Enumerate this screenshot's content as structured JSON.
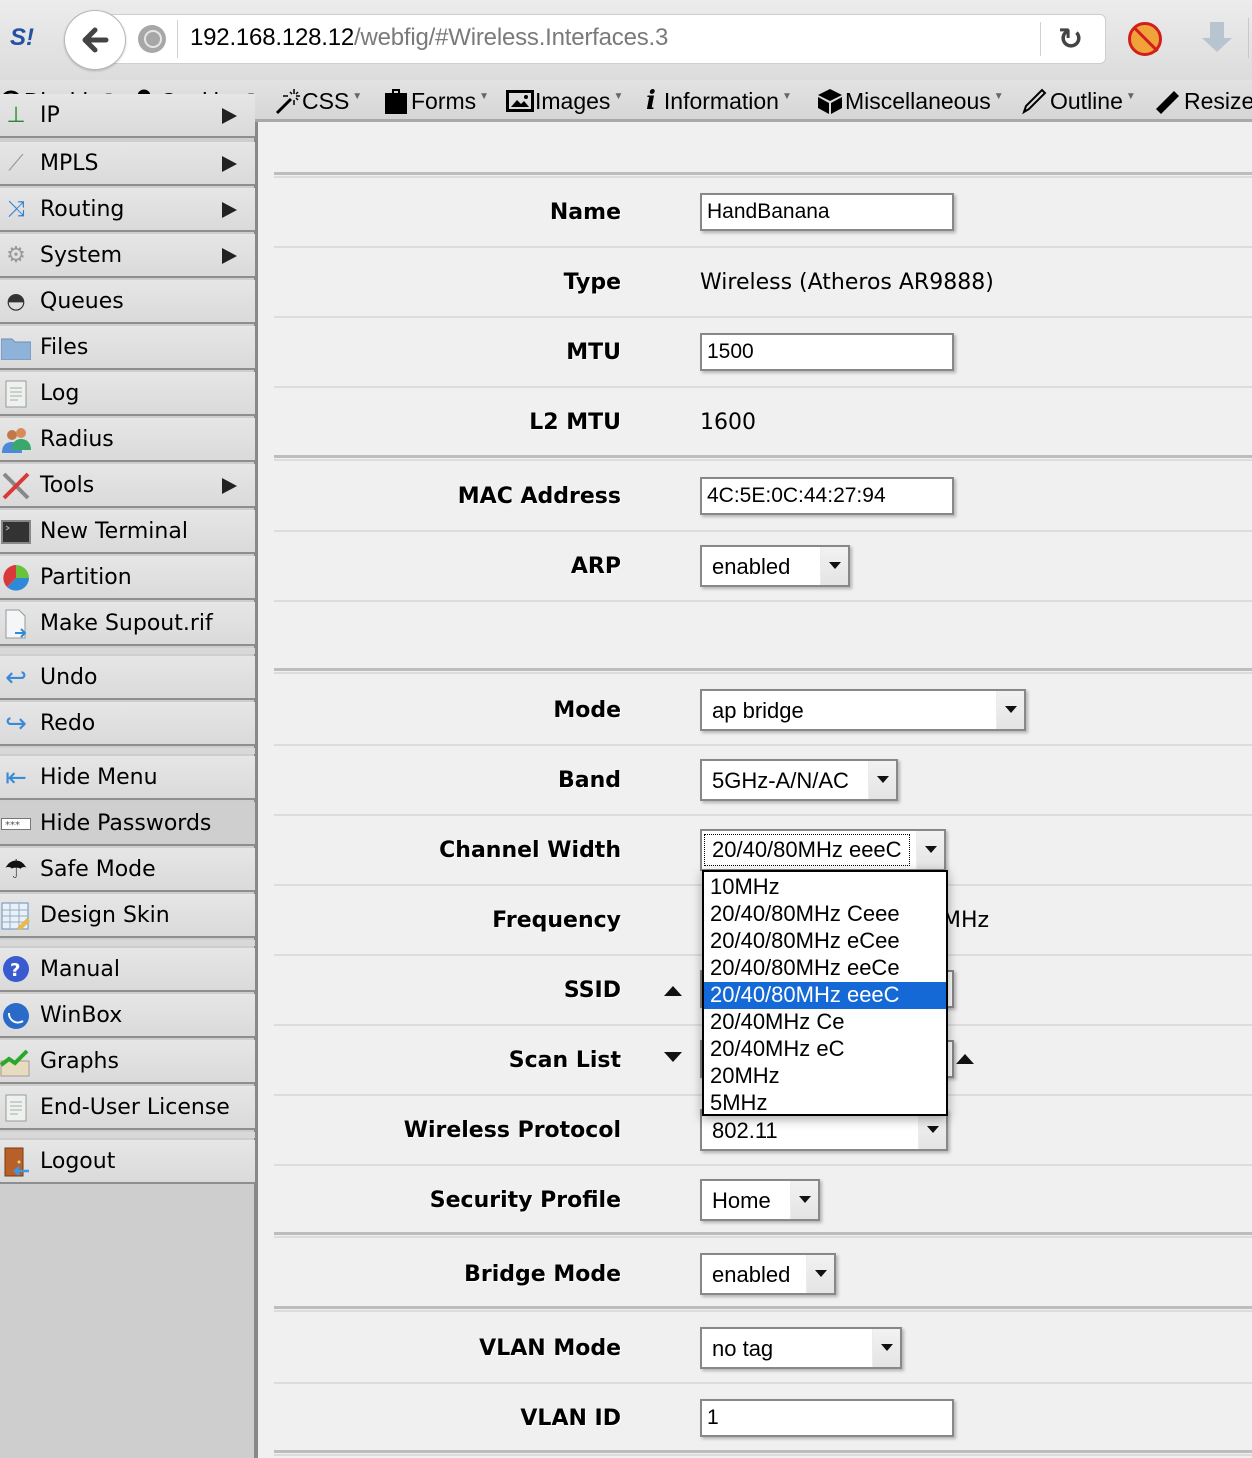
{
  "browser": {
    "url_host": "192.168.128.12",
    "url_path": "/webfig/#Wireless.Interfaces.3",
    "extension_logo": "S!",
    "icons": [
      "back-arrow-icon",
      "globe-icon",
      "reload-icon",
      "noscript-icon",
      "download-icon"
    ]
  },
  "dev_toolbar": {
    "items": [
      {
        "label": "Disable",
        "icon": "⃠",
        "has_menu": true
      },
      {
        "label": "Cookies",
        "icon": "👤",
        "has_menu": true
      },
      {
        "label": "CSS",
        "icon": "✨",
        "has_menu": true
      },
      {
        "label": "Forms",
        "icon": "📋",
        "has_menu": true
      },
      {
        "label": "Images",
        "icon": "🖼",
        "has_menu": true
      },
      {
        "label": "Information",
        "icon": "𝒊",
        "has_menu": true
      },
      {
        "label": "Miscellaneous",
        "icon": "📦",
        "has_menu": true
      },
      {
        "label": "Outline",
        "icon": "✎",
        "has_menu": true
      },
      {
        "label": "Resize",
        "icon": "📏",
        "has_menu": false
      }
    ]
  },
  "sidebar": {
    "items": [
      {
        "label": "IP",
        "icon": "ip-icon",
        "glyph": "⊥",
        "submenu": true
      },
      {
        "label": "MPLS",
        "icon": "mpls-tags-icon",
        "glyph": "🏷",
        "submenu": true
      },
      {
        "label": "Routing",
        "icon": "routing-icon",
        "glyph": "⤨",
        "submenu": true
      },
      {
        "label": "System",
        "icon": "gear-icon",
        "glyph": "⚙",
        "submenu": true
      },
      {
        "label": "Queues",
        "icon": "gauge-icon",
        "glyph": "◓",
        "submenu": false
      },
      {
        "label": "Files",
        "icon": "folder-icon",
        "glyph": "📁",
        "submenu": false
      },
      {
        "label": "Log",
        "icon": "log-document-icon",
        "glyph": "▤",
        "submenu": false
      },
      {
        "label": "Radius",
        "icon": "users-icon",
        "glyph": "👥",
        "submenu": false
      },
      {
        "label": "Tools",
        "icon": "tools-icon",
        "glyph": "✂",
        "submenu": true
      },
      {
        "label": "New Terminal",
        "icon": "terminal-icon",
        "glyph": "▬",
        "submenu": false
      },
      {
        "label": "Partition",
        "icon": "pie-chart-icon",
        "glyph": "◕",
        "submenu": false
      },
      {
        "label": "Make Supout.rif",
        "icon": "file-export-icon",
        "glyph": "🗎",
        "submenu": false
      },
      {
        "label": "Undo",
        "icon": "undo-arrow-icon",
        "glyph": "↩",
        "submenu": false
      },
      {
        "label": "Redo",
        "icon": "redo-arrow-icon",
        "glyph": "↪",
        "submenu": false
      },
      {
        "label": "Hide Menu",
        "icon": "hide-menu-icon",
        "glyph": "⇤",
        "submenu": false
      },
      {
        "label": "Hide Passwords",
        "icon": "password-dots-icon",
        "glyph": "***",
        "submenu": false,
        "active": true
      },
      {
        "label": "Safe Mode",
        "icon": "umbrella-icon",
        "glyph": "☂",
        "submenu": false
      },
      {
        "label": "Design Skin",
        "icon": "design-skin-icon",
        "glyph": "▦",
        "submenu": false
      },
      {
        "label": "Manual",
        "icon": "help-icon",
        "glyph": "?",
        "submenu": false
      },
      {
        "label": "WinBox",
        "icon": "winbox-icon",
        "glyph": "◉",
        "submenu": false
      },
      {
        "label": "Graphs",
        "icon": "graph-icon",
        "glyph": "📈",
        "submenu": false
      },
      {
        "label": "End-User License",
        "icon": "license-document-icon",
        "glyph": "▤",
        "submenu": false
      },
      {
        "label": "Logout",
        "icon": "door-exit-icon",
        "glyph": "🚪",
        "submenu": false
      }
    ]
  },
  "form": {
    "name": {
      "label": "Name",
      "value": "HandBanana"
    },
    "type": {
      "label": "Type",
      "value": "Wireless (Atheros AR9888)"
    },
    "mtu": {
      "label": "MTU",
      "value": "1500"
    },
    "l2mtu": {
      "label": "L2 MTU",
      "value": "1600"
    },
    "mac": {
      "label": "MAC Address",
      "value": "4C:5E:0C:44:27:94"
    },
    "arp": {
      "label": "ARP",
      "value": "enabled"
    },
    "mode": {
      "label": "Mode",
      "value": "ap bridge"
    },
    "band": {
      "label": "Band",
      "value": "5GHz-A/N/AC"
    },
    "channel_width": {
      "label": "Channel Width",
      "value": "20/40/80MHz eeeC",
      "options": [
        "10MHz",
        "20/40/80MHz Ceee",
        "20/40/80MHz eCee",
        "20/40/80MHz eeCe",
        "20/40/80MHz eeeC",
        "20/40MHz Ce",
        "20/40MHz eC",
        "20MHz",
        "5MHz"
      ],
      "selected_index": 4
    },
    "frequency": {
      "label": "Frequency",
      "value_suffix_visible": "MHz"
    },
    "ssid": {
      "label": "SSID"
    },
    "scan_list": {
      "label": "Scan List"
    },
    "wireless_protocol": {
      "label": "Wireless Protocol",
      "value": "802.11"
    },
    "security_profile": {
      "label": "Security Profile",
      "value": "Home"
    },
    "bridge_mode": {
      "label": "Bridge Mode",
      "value": "enabled"
    },
    "vlan_mode": {
      "label": "VLAN Mode",
      "value": "no tag"
    },
    "vlan_id": {
      "label": "VLAN ID",
      "value": "1"
    }
  }
}
